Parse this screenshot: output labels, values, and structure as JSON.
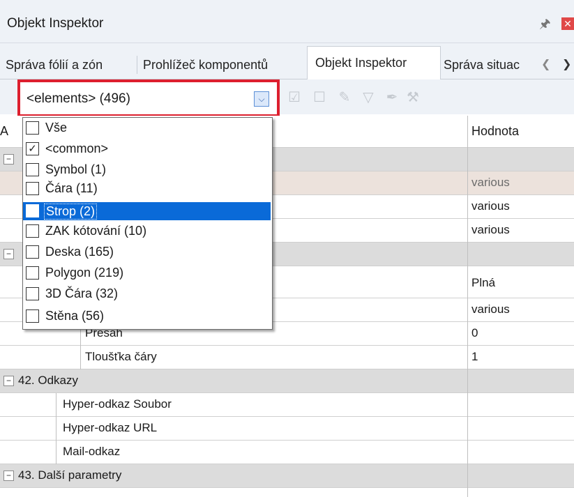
{
  "window": {
    "title": "Objekt Inspektor"
  },
  "tabs": [
    {
      "label": "Správa fólií a zón"
    },
    {
      "label": "Prohlížeč komponentů"
    },
    {
      "label": "Objekt Inspektor"
    },
    {
      "label": "Správa situac"
    }
  ],
  "filter": {
    "selected": "<elements> (496)",
    "options": [
      {
        "label": "Vše",
        "checked": false
      },
      {
        "label": "<common>",
        "checked": true
      },
      {
        "label": "Symbol (1)",
        "checked": false
      },
      {
        "label": "Čára (11)",
        "checked": false
      },
      {
        "label": "Strop (2)",
        "checked": false
      },
      {
        "label": "ZAK kótování (10)",
        "checked": false
      },
      {
        "label": "Deska (165)",
        "checked": false
      },
      {
        "label": "Polygon (219)",
        "checked": false
      },
      {
        "label": "3D Čára (32)",
        "checked": false
      },
      {
        "label": "Stěna (56)",
        "checked": false
      }
    ]
  },
  "grid": {
    "header_attr": "A",
    "header_value": "Hodnota",
    "rows": {
      "r0": {
        "value": ""
      },
      "r1": {
        "value": "various"
      },
      "r2": {
        "value": "various"
      },
      "r3": {
        "value": "various"
      },
      "r4": {
        "value": ""
      },
      "r5": {
        "value": "Plná"
      },
      "r6": {
        "value": "various"
      },
      "r7": {
        "name": "Přesah",
        "value": "0"
      },
      "r8": {
        "name": "Tloušťka čáry",
        "value": "1"
      },
      "g42": {
        "title": "42. Odkazy"
      },
      "r9": {
        "name": "Hyper-odkaz Soubor",
        "value": ""
      },
      "r10": {
        "name": "Hyper-odkaz URL",
        "value": ""
      },
      "r11": {
        "name": "Mail-odkaz",
        "value": ""
      },
      "g43": {
        "title": "43. Další parametry"
      }
    }
  }
}
